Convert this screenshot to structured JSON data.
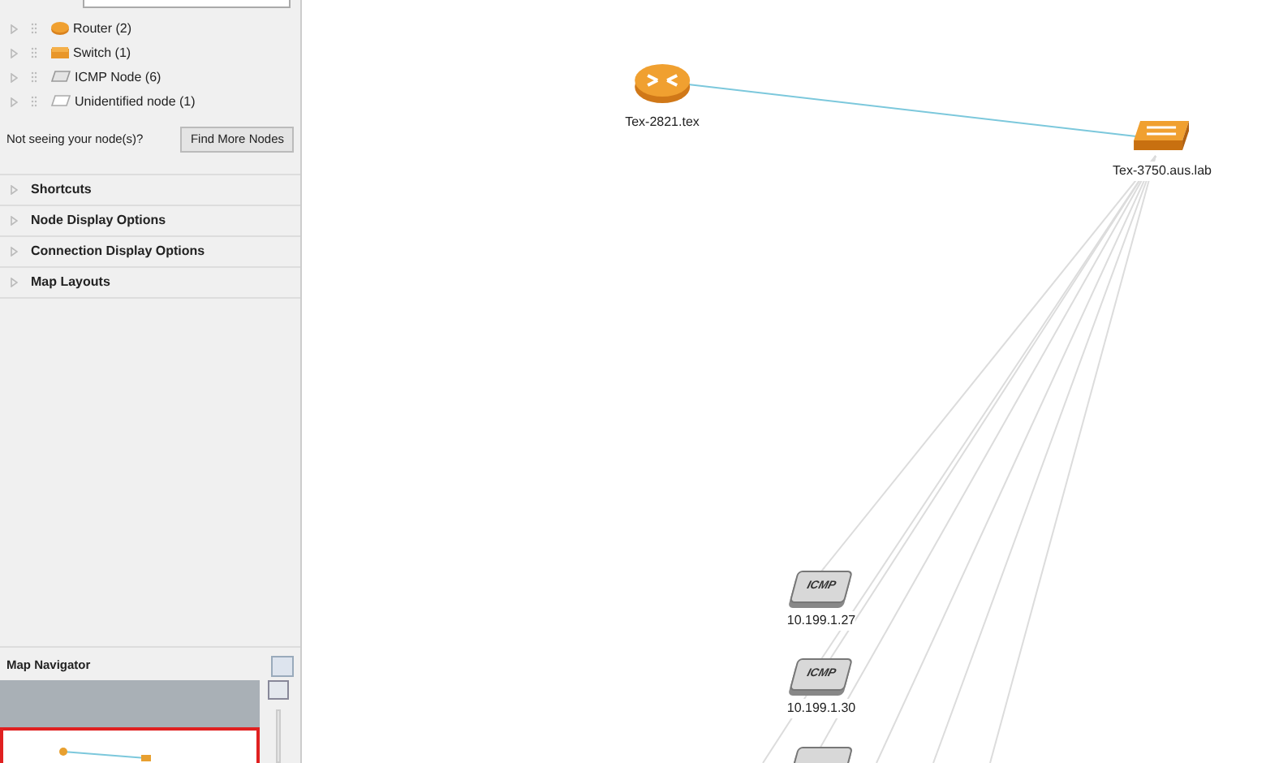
{
  "node_groups": [
    {
      "label": "Router (2)",
      "kind": "router"
    },
    {
      "label": "Switch (1)",
      "kind": "switch"
    },
    {
      "label": "ICMP Node (6)",
      "kind": "icmp"
    },
    {
      "label": "Unidentified node (1)",
      "kind": "unknown"
    }
  ],
  "find_more": {
    "prompt": "Not seeing your node(s)?",
    "button": "Find More Nodes"
  },
  "sections": [
    {
      "label": "Shortcuts",
      "expanded": false
    },
    {
      "label": "Node Display Options",
      "expanded": false
    },
    {
      "label": "Connection Display Options",
      "expanded": false
    },
    {
      "label": "Map Layouts",
      "expanded": false
    }
  ],
  "map_navigator": {
    "title": "Map Navigator"
  },
  "map_nodes": [
    {
      "label": "Tex-2821.tex",
      "kind": "router"
    },
    {
      "label": "Tex-3750.aus.lab",
      "kind": "switch"
    },
    {
      "label": "10.199.1.27",
      "kind": "icmp",
      "badge": "ICMP"
    },
    {
      "label": "10.199.1.30",
      "kind": "icmp",
      "badge": "ICMP"
    },
    {
      "kind": "icmp"
    }
  ]
}
